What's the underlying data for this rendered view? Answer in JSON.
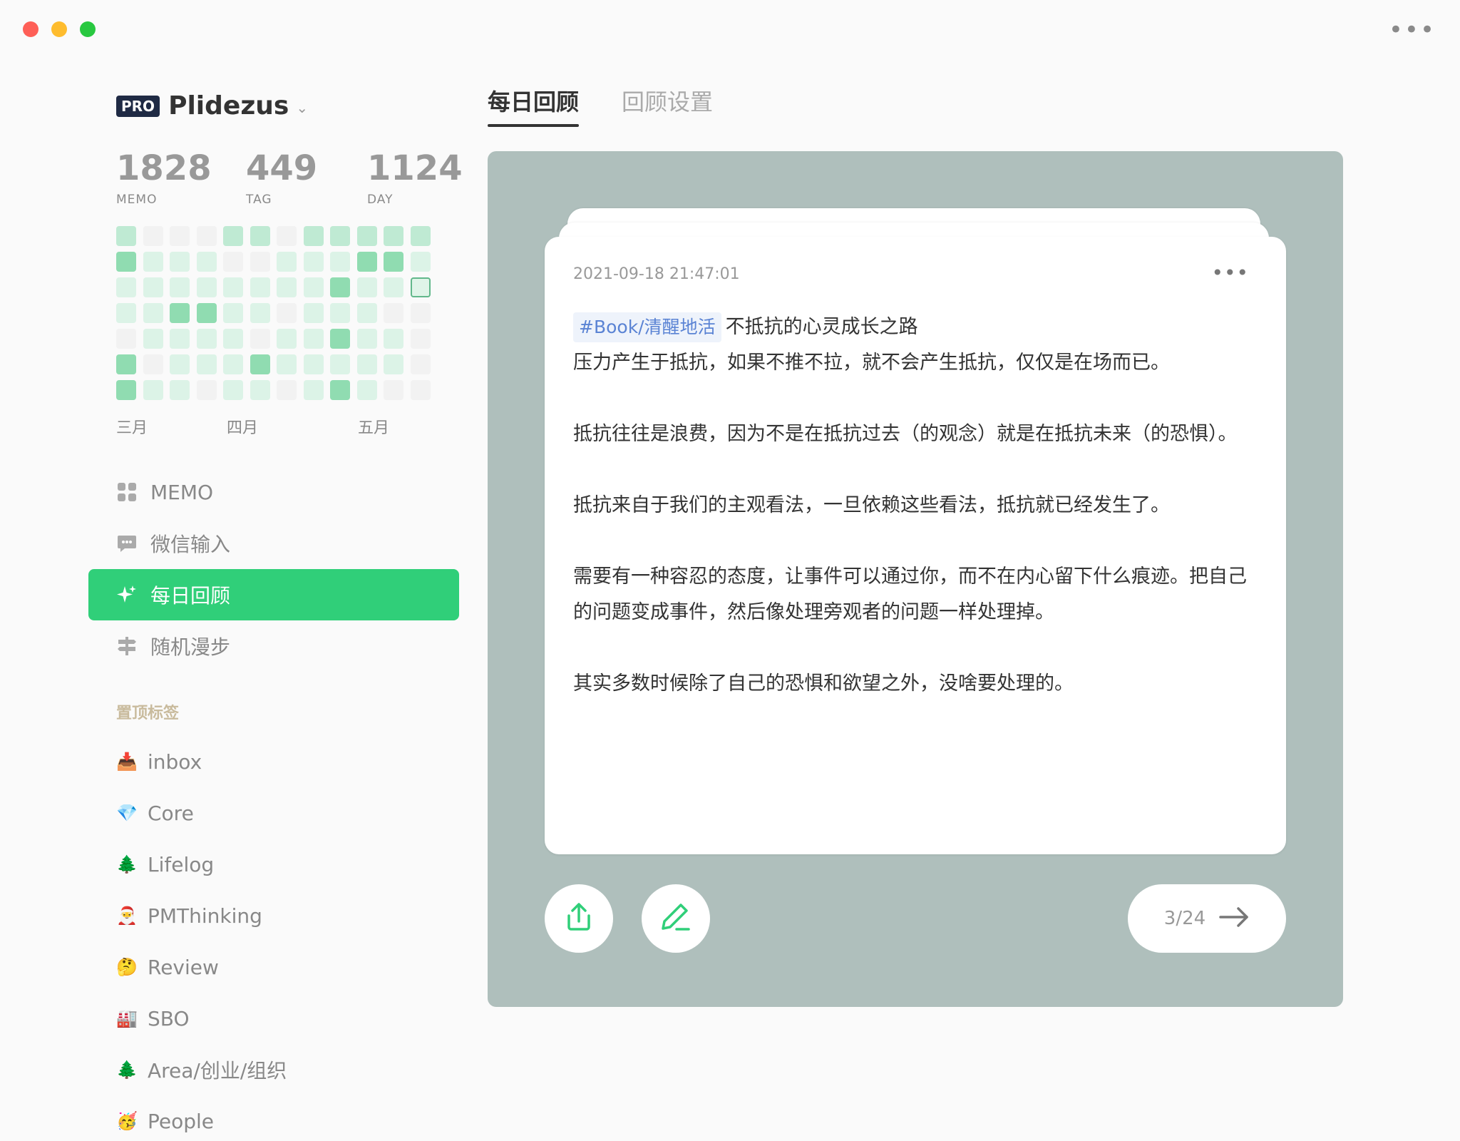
{
  "window": {
    "menu_label": "•••"
  },
  "brand": {
    "badge": "PRO",
    "name": "Plidezus",
    "caret": "⌄"
  },
  "stats": [
    {
      "value": "1828",
      "label": "MEMO"
    },
    {
      "value": "449",
      "label": "TAG"
    },
    {
      "value": "1124",
      "label": "DAY"
    }
  ],
  "heatmap": {
    "colors": [
      "#f2f2f2",
      "#dcf3e7",
      "#bfead3",
      "#90dcb1"
    ],
    "today_color": "#dff4e8",
    "rows": [
      [
        2,
        0,
        0,
        0,
        2,
        2,
        0,
        2,
        2,
        2,
        2,
        2
      ],
      [
        3,
        1,
        1,
        1,
        0,
        0,
        1,
        1,
        1,
        3,
        3,
        1
      ],
      [
        1,
        1,
        1,
        1,
        1,
        1,
        1,
        1,
        3,
        1,
        1,
        -1
      ],
      [
        1,
        1,
        3,
        3,
        1,
        1,
        0,
        1,
        1,
        1,
        0,
        0
      ],
      [
        0,
        1,
        1,
        1,
        1,
        0,
        1,
        1,
        3,
        1,
        1,
        0
      ],
      [
        3,
        0,
        1,
        1,
        1,
        3,
        1,
        1,
        1,
        1,
        1,
        0
      ],
      [
        3,
        1,
        1,
        0,
        1,
        1,
        0,
        1,
        3,
        1,
        0,
        0
      ]
    ],
    "months": [
      "三月",
      "四月",
      "五月"
    ]
  },
  "nav": [
    {
      "icon": "grid-icon",
      "label": "MEMO",
      "active": false
    },
    {
      "icon": "chat-icon",
      "label": "微信输入",
      "active": false
    },
    {
      "icon": "sparkle-icon",
      "label": "每日回顾",
      "active": true
    },
    {
      "icon": "signpost-icon",
      "label": "随机漫步",
      "active": false
    }
  ],
  "pinned": {
    "title": "置顶标签",
    "tags": [
      {
        "emoji": "📥",
        "label": "inbox"
      },
      {
        "emoji": "💎",
        "label": "Core"
      },
      {
        "emoji": "🌲",
        "label": "Lifelog"
      },
      {
        "emoji": "🎅",
        "label": "PMThinking"
      },
      {
        "emoji": "🤔",
        "label": "Review"
      },
      {
        "emoji": "🏭",
        "label": "SBO"
      },
      {
        "emoji": "🌲",
        "label": "Area/创业/组织"
      },
      {
        "emoji": "🥳",
        "label": "People"
      }
    ]
  },
  "tabs": [
    {
      "label": "每日回顾",
      "active": true
    },
    {
      "label": "回顾设置",
      "active": false
    }
  ],
  "memo": {
    "timestamp": "2021-09-18 21:47:01",
    "more": "•••",
    "tag": "#Book/清醒地活",
    "title_text": "不抵抗的心灵成长之路",
    "lines": [
      "压力产生于抵抗，如果不推不拉，就不会产生抵抗，仅仅是在场而已。",
      "",
      "抵抗往往是浪费，因为不是在抵抗过去（的观念）就是在抵抗未来（的恐惧）。",
      "",
      "抵抗来自于我们的主观看法，一旦依赖这些看法，抵抗就已经发生了。",
      "",
      "需要有一种容忍的态度，让事件可以通过你，而不在内心留下什么痕迹。把自己的问题变成事件，然后像处理旁观者的问题一样处理掉。",
      "",
      "其实多数时候除了自己的恐惧和欲望之外，没啥要处理的。"
    ]
  },
  "pager": {
    "text": "3/24"
  },
  "accent": "#30cf79"
}
